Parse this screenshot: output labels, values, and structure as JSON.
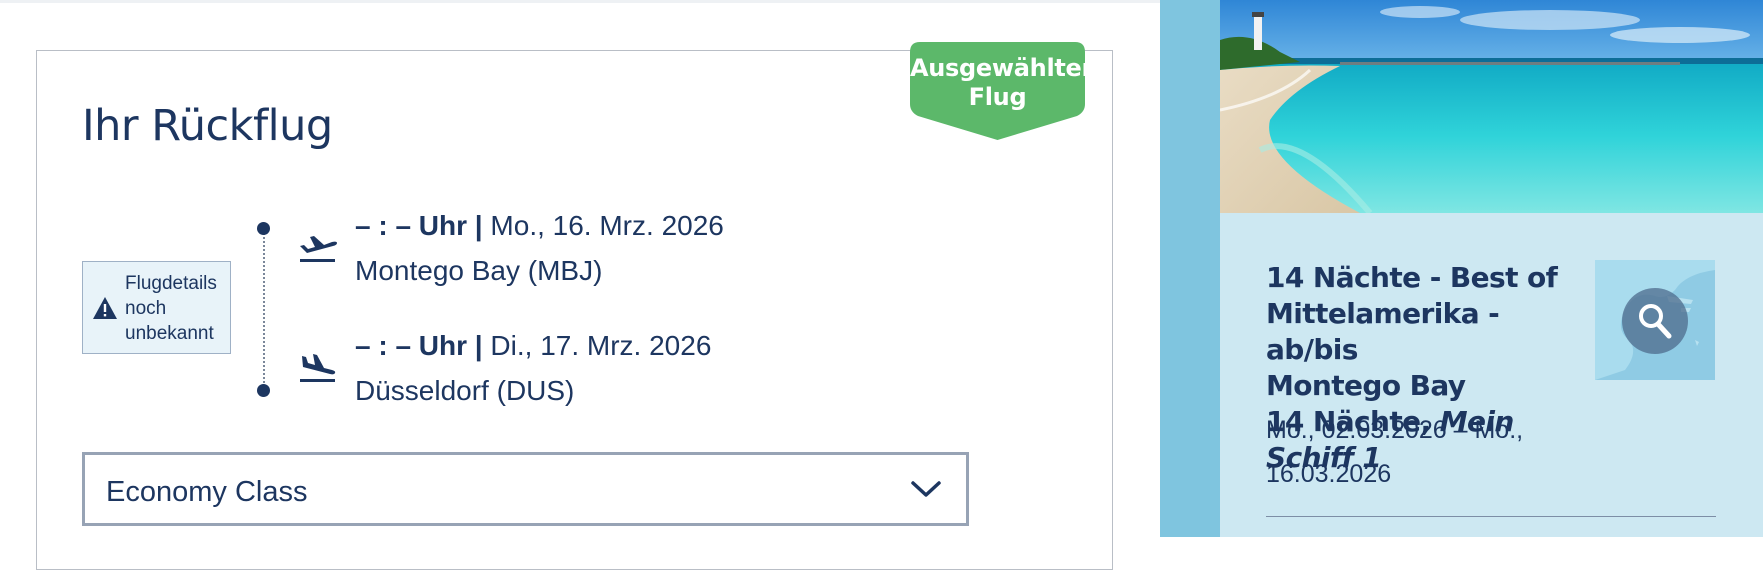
{
  "flight": {
    "badge_line1": "Ausgewählter",
    "badge_line2": "Flug",
    "title": "Ihr Rückflug",
    "warning": "Flugdetails noch unbekannt",
    "departure": {
      "time": "– : – Uhr |",
      "date": "Mo., 16. Mrz. 2026",
      "airport": "Montego Bay (MBJ)",
      "icon": "plane-takeoff-icon"
    },
    "arrival": {
      "time": "– : – Uhr |",
      "date": "Di., 17. Mrz. 2026",
      "airport": "Düsseldorf (DUS)",
      "icon": "plane-landing-icon"
    },
    "cabin_class": "Economy Class"
  },
  "offer": {
    "line1": "14 Nächte - Best of",
    "line2": "Mittelamerika - ab/bis",
    "line3": "Montego Bay",
    "line4_prefix": "14 Nächte, ",
    "ship": "Mein Schiff 1",
    "dates_line1": "Mo., 02.03.2026 – Mo.,",
    "dates_line2": "16.03.2026"
  },
  "colors": {
    "text": "#1d3660",
    "badge": "#5cb86a",
    "sidebar": "#7fc5df",
    "panel": "#cde8f2"
  }
}
